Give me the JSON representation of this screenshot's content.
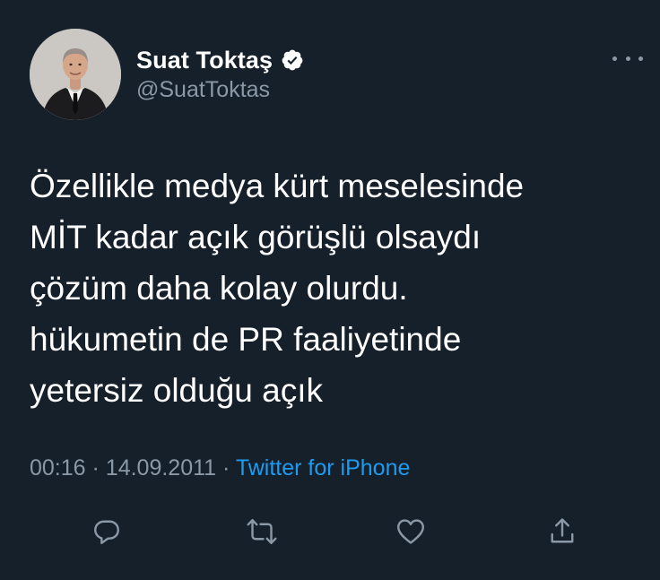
{
  "user": {
    "display_name": "Suat Toktaş",
    "handle": "@SuatToktas",
    "verified": true
  },
  "tweet": {
    "text": "Özellikle medya kürt meselesinde\nMİT kadar açık görüşlü olsaydı\nçözüm daha kolay olurdu.\nhükumetin de PR faaliyetinde\nyetersiz olduğu açık",
    "time": "00:16",
    "date": "14.09.2011",
    "separator": "·",
    "source": "Twitter for iPhone"
  },
  "icons": {
    "more": "more-options-icon",
    "reply": "reply-icon",
    "retweet": "retweet-icon",
    "like": "like-icon",
    "share": "share-icon",
    "verified": "verified-badge-icon"
  },
  "colors": {
    "background": "#15202b",
    "primary_text": "#ffffff",
    "secondary_text": "#8b98a5",
    "link": "#1d9bf0"
  }
}
